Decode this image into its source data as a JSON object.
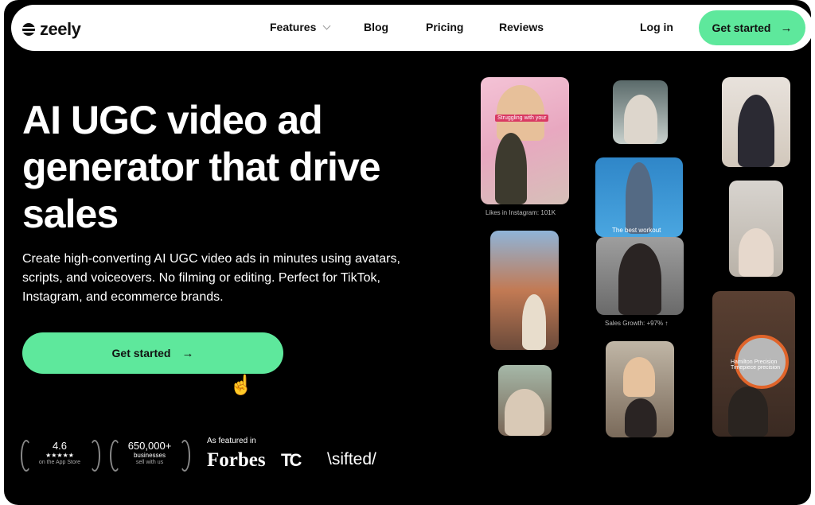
{
  "nav": {
    "logo_text": "zeely",
    "links": [
      "Features",
      "Blog",
      "Pricing",
      "Reviews"
    ],
    "login": "Log in",
    "cta": "Get started"
  },
  "hero": {
    "title": "AI UGC video ad generator that drive sales",
    "subtitle": "Create high-converting AI UGC video ads in minutes using avatars, scripts, and voiceovers. No filming or editing. Perfect for TikTok, Instagram, and ecommerce brands.",
    "cta": "Get started"
  },
  "badges": [
    {
      "value": "4.6",
      "line2": "★★★★★",
      "line3": "on the App Store"
    },
    {
      "value": "650,000+",
      "line2": "businesses",
      "line3": "sell with us"
    }
  ],
  "featured": {
    "label": "As featured in",
    "logos": [
      "Forbes",
      "TC",
      "\\sifted/"
    ]
  },
  "cards": {
    "c1_caption": "Likes in Instagram: 101K",
    "c1_overlay": "Struggling with your",
    "c4_overlay": "The best workout",
    "c5_caption": "Sales Growth: +97% ↑",
    "c9_overlay": "Hamilton Precision Timepiece precision"
  },
  "icons": [
    "arrow-right-icon",
    "chevron-down-icon",
    "hand-cursor-icon",
    "laurel-icon",
    "zeely-logo-icon"
  ]
}
